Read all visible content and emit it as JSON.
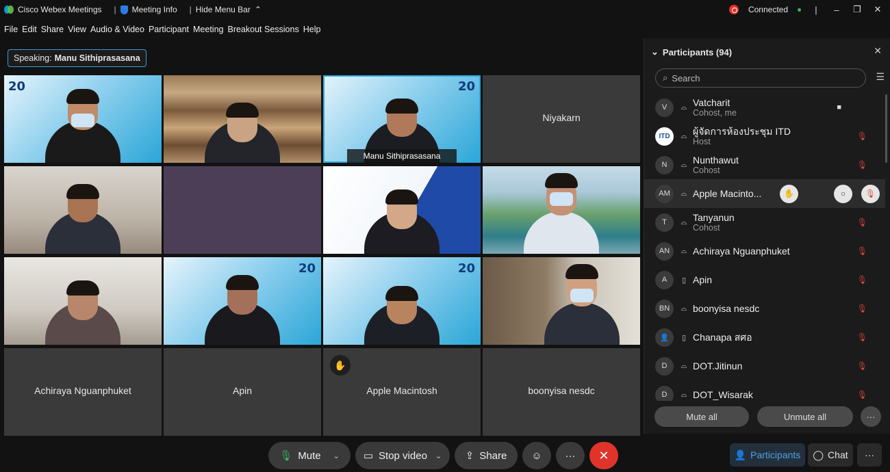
{
  "titlebar": {
    "app_name": "Cisco Webex Meetings",
    "meeting_info": "Meeting Info",
    "hide_menu": "Hide Menu Bar",
    "status": "Connected"
  },
  "menu": [
    "File",
    "Edit",
    "Share",
    "View",
    "Audio & Video",
    "Participant",
    "Meeting",
    "Breakout Sessions",
    "Help"
  ],
  "speaking": {
    "label": "Speaking:",
    "name": "Manu Sithiprasasana"
  },
  "tiles": [
    {
      "name": ""
    },
    {
      "name": ""
    },
    {
      "name": "Manu Sithiprasasana"
    },
    {
      "name": "Niyakarn"
    },
    {
      "name": ""
    },
    {
      "name": ""
    },
    {
      "name": ""
    },
    {
      "name": ""
    },
    {
      "name": ""
    },
    {
      "name": ""
    },
    {
      "name": ""
    },
    {
      "name": ""
    },
    {
      "name": "Achiraya Nguanphuket"
    },
    {
      "name": "Apin"
    },
    {
      "name": "Apple Macintosh"
    },
    {
      "name": "boonyisa nesdc"
    }
  ],
  "badge": "20",
  "participants": {
    "title": "Participants (94)",
    "search_placeholder": "Search",
    "list": [
      {
        "initials": "V",
        "name": "Vatcharit",
        "role": "Cohost, me"
      },
      {
        "initials": "ITD",
        "name": "ผู้จัดการห้องประชุม ITD",
        "role": "Host"
      },
      {
        "initials": "N",
        "name": "Nunthawut",
        "role": "Cohost"
      },
      {
        "initials": "AM",
        "name": "Apple Macinto...",
        "role": ""
      },
      {
        "initials": "T",
        "name": "Tanyanun",
        "role": "Cohost"
      },
      {
        "initials": "AN",
        "name": "Achiraya Nguanphuket",
        "role": ""
      },
      {
        "initials": "A",
        "name": "Apin",
        "role": ""
      },
      {
        "initials": "BN",
        "name": "boonyisa nesdc",
        "role": ""
      },
      {
        "initials": "",
        "name": "Chanapa สศอ",
        "role": ""
      },
      {
        "initials": "D",
        "name": "DOT.Jitinun",
        "role": ""
      },
      {
        "initials": "D",
        "name": "DOT_Wisarak",
        "role": ""
      }
    ],
    "mute_all": "Mute all",
    "unmute_all": "Unmute all"
  },
  "toolbar": {
    "mute": "Mute",
    "stop_video": "Stop video",
    "share": "Share",
    "participants": "Participants",
    "chat": "Chat"
  },
  "colors": {
    "accent": "#27a9e1",
    "danger": "#e0342b",
    "connected": "#3cb45c"
  }
}
